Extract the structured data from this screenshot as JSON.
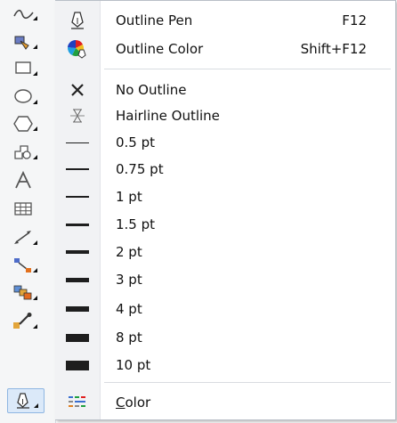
{
  "toolbar": {
    "tools": [
      {
        "icon": "freehand-tool-icon"
      },
      {
        "icon": "smart-fill-tool-icon"
      },
      {
        "icon": "rectangle-tool-icon"
      },
      {
        "icon": "ellipse-tool-icon"
      },
      {
        "icon": "polygon-tool-icon"
      },
      {
        "icon": "basic-shapes-tool-icon"
      },
      {
        "icon": "text-tool-icon"
      },
      {
        "icon": "table-tool-icon"
      },
      {
        "icon": "dimension-tool-icon"
      },
      {
        "icon": "connector-tool-icon"
      },
      {
        "icon": "blend-tool-icon"
      },
      {
        "icon": "eyedropper-tool-icon"
      },
      {
        "icon": "outline-pen-tool-icon"
      }
    ],
    "active_tool": "outline-pen-tool-icon"
  },
  "menu": {
    "outline_pen": {
      "label": "Outline Pen",
      "shortcut": "F12"
    },
    "outline_color": {
      "label": "Outline Color",
      "shortcut": "Shift+F12"
    },
    "no_outline": {
      "label": "No Outline"
    },
    "hairline_outline": {
      "label": "Hairline Outline"
    },
    "widths": [
      {
        "label": "0.5 pt",
        "value_pt": 0.5
      },
      {
        "label": "0.75 pt",
        "value_pt": 0.75
      },
      {
        "label": "1 pt",
        "value_pt": 1
      },
      {
        "label": "1.5 pt",
        "value_pt": 1.5
      },
      {
        "label": "2 pt",
        "value_pt": 2
      },
      {
        "label": "3 pt",
        "value_pt": 3
      },
      {
        "label": "4 pt",
        "value_pt": 4
      },
      {
        "label": "8 pt",
        "value_pt": 8
      },
      {
        "label": "10 pt",
        "value_pt": 10
      }
    ],
    "color": {
      "label_first": "C",
      "label_rest": "olor"
    }
  }
}
